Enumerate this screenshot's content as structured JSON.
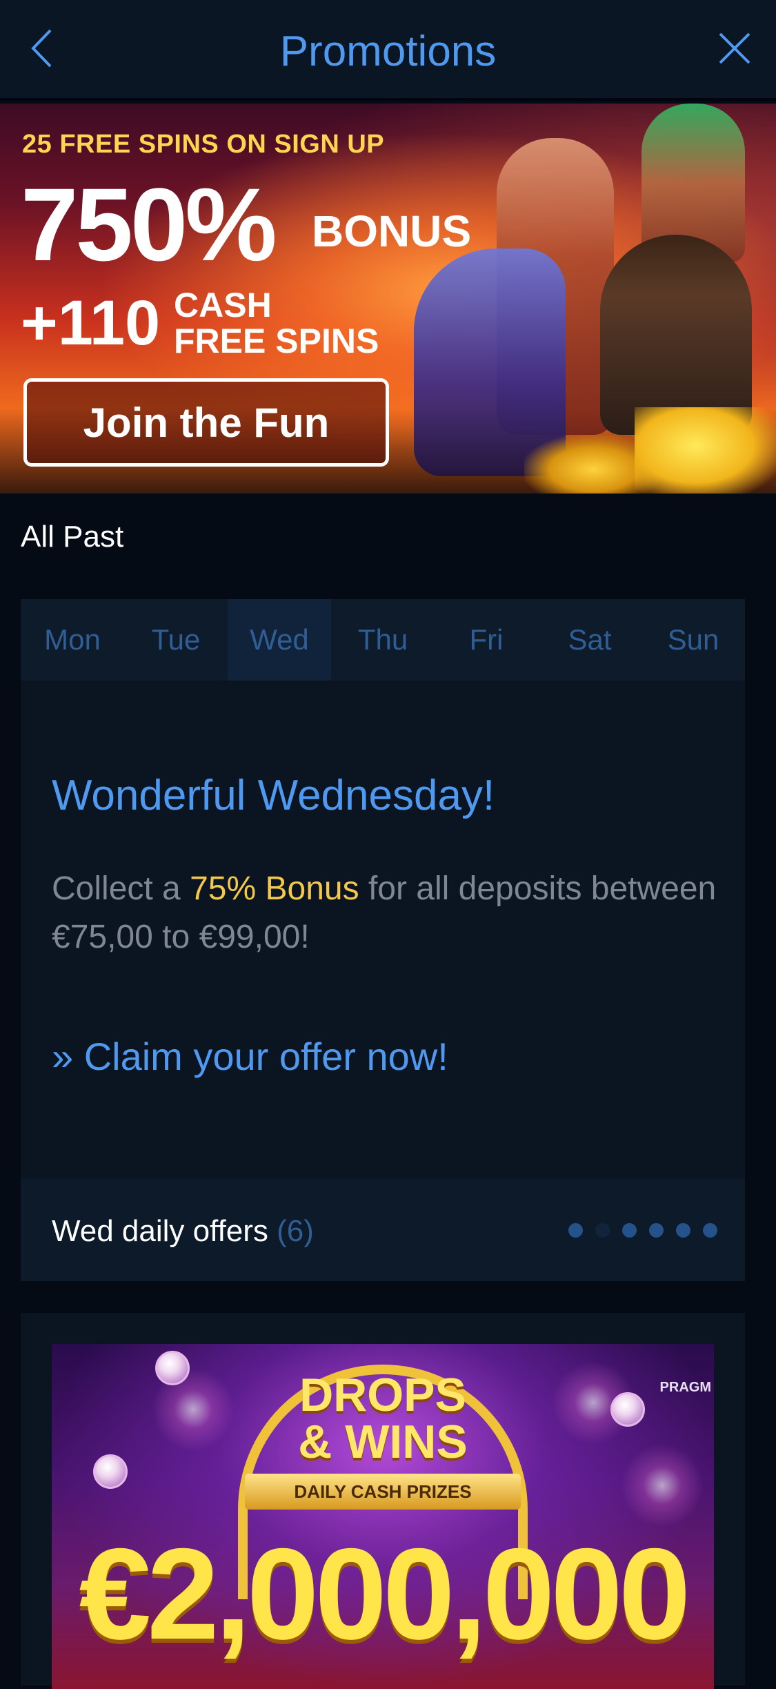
{
  "header": {
    "title": "Promotions",
    "back_icon": "chevron-left-icon",
    "close_icon": "close-icon",
    "accent": "#4f9af0"
  },
  "hero_banner": {
    "line1": "25 FREE SPINS ON SIGN UP",
    "big_percent": "750%",
    "bonus": "BONUS",
    "plus_value": "+110",
    "cash_line1": "CASH",
    "cash_line2": "FREE SPINS",
    "cta": "Join the Fun"
  },
  "filter": {
    "all": "All",
    "past": "Past"
  },
  "daily": {
    "days": [
      "Mon",
      "Tue",
      "Wed",
      "Thu",
      "Fri",
      "Sat",
      "Sun"
    ],
    "active_day": "Wed",
    "offer_title": "Wonderful Wednesday!",
    "offer_text_before": "Collect a ",
    "offer_highlight": "75% Bonus",
    "offer_text_after": " for all deposits between €75,00 to €99,00!",
    "claim": "» Claim your offer now!",
    "footer_label": "Wed daily offers",
    "footer_count": "(6)",
    "pagination_total": 6,
    "pagination_current": 2,
    "highlight_color": "#f4c84a"
  },
  "promo2": {
    "drops_line1": "DROPS",
    "drops_line2": "& WINS",
    "ribbon": "DAILY CASH PRIZES",
    "amount": "€2,000,000",
    "brand": "PRAGM"
  }
}
